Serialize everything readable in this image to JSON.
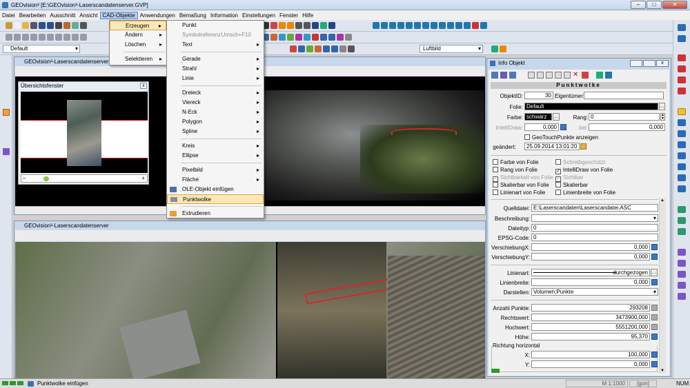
{
  "window": {
    "title": "GEOvision³ [E:\\GEOvision³-Laserscandatenserver.GVP]"
  },
  "menubar": [
    "Datei",
    "Bearbeiten",
    "Ausschnitt",
    "Ansicht",
    "CAD-Objekte",
    "Anwendungen",
    "Bemaßung",
    "Information",
    "Einstellungen",
    "Fenster",
    "Hilfe"
  ],
  "toolbar": {
    "layer": "Default",
    "bild": "Luftbild"
  },
  "cad_menu": [
    "Erzeugen",
    "Ändern",
    "Löschen",
    "Selektieren"
  ],
  "erzeugen_menu": {
    "punkt": "Punkt",
    "symbolreferenz": "Symbolreferenz",
    "symbol_shortcut": "Umsch+F10",
    "text": "Text",
    "gerade": "Gerade",
    "strahl": "Strahl",
    "linie": "Linie",
    "dreieck": "Dreieck",
    "viereck": "Viereck",
    "neck": "N-Eck",
    "polygon": "Polygon",
    "spline": "Spline",
    "kreis": "Kreis",
    "ellipse": "Ellipse",
    "pixelbild": "Pixelbild",
    "flaeche": "Fläche",
    "ole": "OLE-Objekt einfügen",
    "punktwolke": "Punktwolke",
    "extrudieren": "Extrudieren"
  },
  "view1": {
    "title": "GEOvision³-Laserscandatenserver (1)"
  },
  "overview": {
    "title": "Übersichtsfenster"
  },
  "view2": {
    "title": "GEOvision³-Laserscandatenserver"
  },
  "info": {
    "title": "Info Objekt",
    "header": "Punktwolke",
    "objektid_label": "ObjektID:",
    "objektid": "30",
    "eigentuemer_label": "Eigentümer:",
    "folie_label": "Folie:",
    "folie": "Default",
    "farbe_label": "Farbe:",
    "farbe": "schwarz",
    "rang_label": "Rang:",
    "rang": "0",
    "intellidraw_label": "IntelliDraw:",
    "intellidraw": "0,000",
    "bei_label": "bei:",
    "bei": "0,000",
    "geotouch": "GeoTouchPunkte anzeigen",
    "geaendert_label": "geändert:",
    "geaendert": "25.09.2014 13:01:20",
    "cb": [
      "Farbe von Folie",
      "Schreibgeschützt",
      "Rang von Folie",
      "IntelliDraw von Folie",
      "Sichtbarkeit von Folie",
      "Sichtbar",
      "Skalierbar von Folie",
      "Skalierbar",
      "Linienart von Folie",
      "Linienbreite von Folie"
    ],
    "quelldatei_label": "Quelldatei:",
    "quelldatei": "E:\\Laserscandaten\\Laserscandatei.ASC",
    "beschreibung_label": "Beschreibung:",
    "dateityp_label": "Dateityp:",
    "dateityp": "0",
    "epsg_label": "EPSG-Code:",
    "epsg": "0",
    "verschx_label": "VerschiebungX:",
    "verschx": "0,000",
    "verschy_label": "VerschiebungY:",
    "verschy": "0,000",
    "linienart_label": "Linienart:",
    "linienart": "durchgezogen",
    "linienbreite_label": "Linienbreite:",
    "linienbreite": "0,000",
    "darstellen_label": "Darstellen:",
    "darstellen": "Volumen;Punkte",
    "anzahl_label": "Anzahl Punkte:",
    "anzahl": "293208",
    "rechts_label": "Rechtswert:",
    "rechts": "3473900,000",
    "hoch_label": "Hochwert:",
    "hoch": "5551200,000",
    "hoehe_label": "Höhe:",
    "hoehe": "95,370",
    "richtung": "Richtung horizontal",
    "x_label": "X:",
    "x": "100,000",
    "y_label": "Y:",
    "y": "0,000"
  },
  "status": {
    "text": "Punktwolke einfügen",
    "scale": "M 1:1000",
    "unit": "[gon]",
    "num": "NUM"
  }
}
